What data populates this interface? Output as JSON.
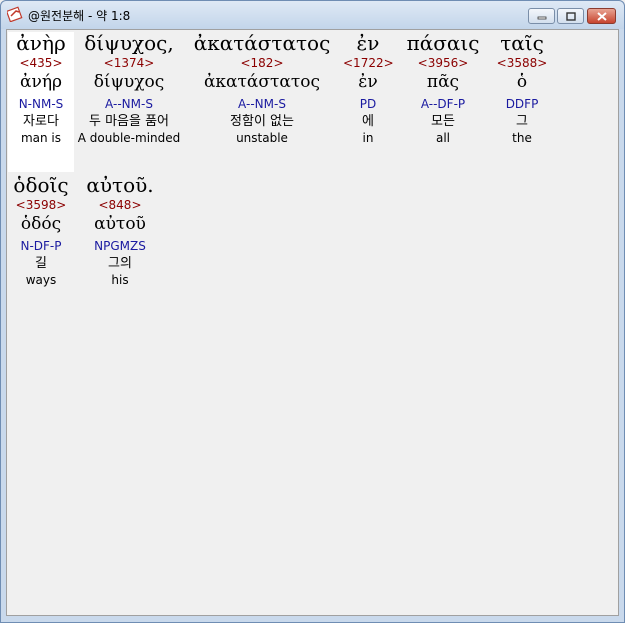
{
  "window": {
    "title": "@원전분해 - 약 1:8"
  },
  "words": [
    {
      "greek": "ἀνὴρ",
      "strong": "<435>",
      "lemma": "ἀνήρ",
      "parse": "N-NM-S",
      "korean": "자로다",
      "english": "man is"
    },
    {
      "greek": "δίψυχος,",
      "strong": "<1374>",
      "lemma": "δίψυχος",
      "parse": "A--NM-S",
      "korean": "두 마음을 품어",
      "english": "A double-minded"
    },
    {
      "greek": "ἀκατάστατος",
      "strong": "<182>",
      "lemma": "ἀκατάστατος",
      "parse": "A--NM-S",
      "korean": "정함이 없는",
      "english": "unstable"
    },
    {
      "greek": "ἐν",
      "strong": "<1722>",
      "lemma": "ἐν",
      "parse": "PD",
      "korean": "에",
      "english": "in"
    },
    {
      "greek": "πάσαις",
      "strong": "<3956>",
      "lemma": "πᾶς",
      "parse": "A--DF-P",
      "korean": "모든",
      "english": "all"
    },
    {
      "greek": "ταῖς",
      "strong": "<3588>",
      "lemma": "ὁ",
      "parse": "DDFP",
      "korean": "그",
      "english": "the"
    },
    {
      "greek": "ὁδοῖς",
      "strong": "<3598>",
      "lemma": "ὁδός",
      "parse": "N-DF-P",
      "korean": "길",
      "english": "ways"
    },
    {
      "greek": "αὐτοῦ.",
      "strong": "<848>",
      "lemma": "αὐτοῦ",
      "parse": "NPGMZS",
      "korean": "그의",
      "english": "his"
    }
  ]
}
